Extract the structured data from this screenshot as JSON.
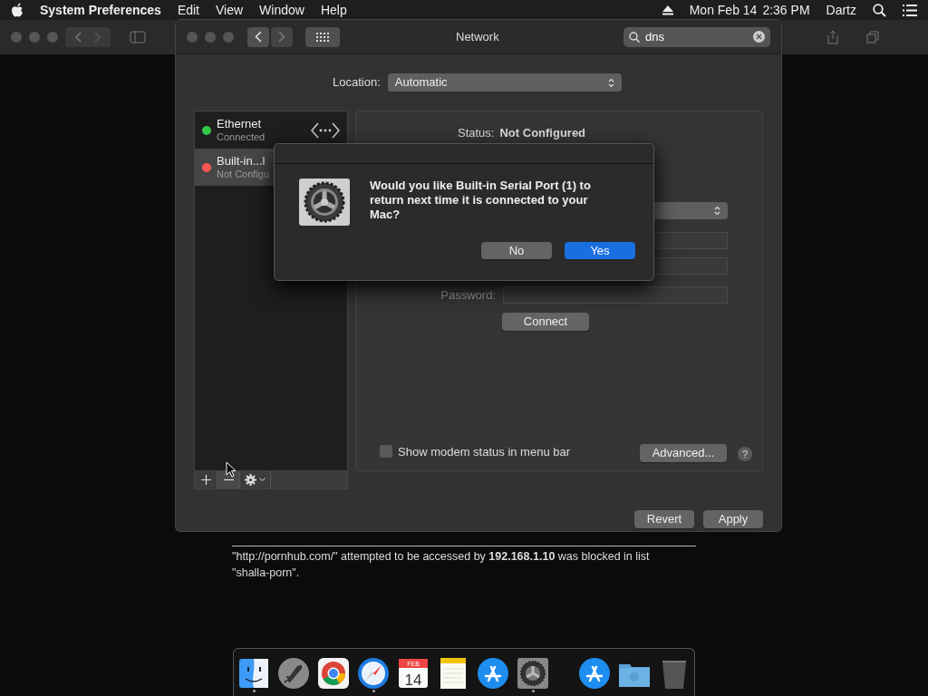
{
  "menu_bar": {
    "app": "System Preferences",
    "menus": [
      "Edit",
      "View",
      "Window",
      "Help"
    ],
    "date": "Mon Feb 14",
    "time": "2:36 PM",
    "user": "Dartz"
  },
  "window": {
    "title": "Network",
    "search": {
      "value": "dns"
    }
  },
  "location": {
    "label": "Location:",
    "value": "Automatic"
  },
  "services": [
    {
      "name": "Ethernet",
      "status": "Connected",
      "color": "#33c748",
      "selected": false
    },
    {
      "name": "Built-in...l",
      "status": "Not Configu",
      "color": "#fc5753",
      "selected": true
    }
  ],
  "detail": {
    "status_label": "Status:",
    "status_value": "Not Configured",
    "password_label": "Password:",
    "connect": "Connect",
    "modem_status": {
      "label": "Show modem status in menu bar",
      "checked": false
    },
    "advanced": "Advanced...",
    "help": "?"
  },
  "buttons": [
    "Revert",
    "Apply"
  ],
  "dialog": {
    "message": "Would you like Built-in Serial Port (1) to return next time it is connected to your Mac?",
    "buttons": [
      {
        "label": "No",
        "default": false
      },
      {
        "label": "Yes",
        "default": true
      }
    ]
  },
  "notice": "\"http://pornhub.com/\" attempted to be accessed by **192.168.1.10** was blocked in list \"shalla-porn\".",
  "dock": {
    "apps": [
      {
        "kind": "finder",
        "running": true
      },
      {
        "kind": "rocket",
        "running": false
      },
      {
        "kind": "browser",
        "running": false
      },
      {
        "kind": "compass",
        "running": true
      },
      {
        "kind": "calendar",
        "month": "FEB",
        "day": "14",
        "running": false
      },
      {
        "kind": "notes",
        "running": false
      },
      {
        "kind": "store",
        "running": false
      },
      {
        "kind": "gear",
        "running": true
      }
    ],
    "others": [
      {
        "kind": "store",
        "running": false
      },
      {
        "kind": "folder",
        "running": false
      },
      {
        "kind": "trash",
        "running": false
      }
    ]
  }
}
